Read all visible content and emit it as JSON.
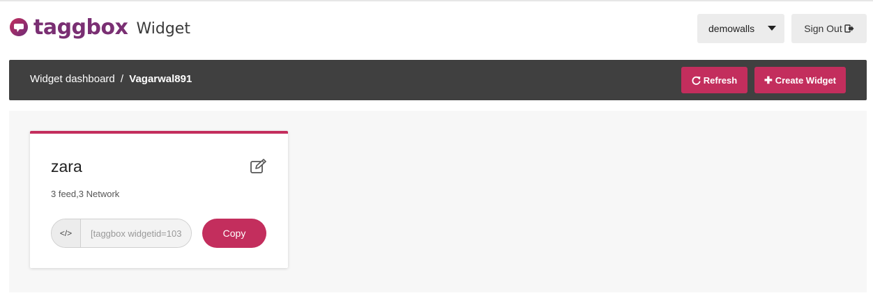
{
  "brand": {
    "name": "taggbox",
    "product": "Widget",
    "accent_color": "#c32e5d",
    "logo_color": "#7a2f73"
  },
  "header": {
    "account_label": "demowalls",
    "signout_label": "Sign Out"
  },
  "dashbar": {
    "breadcrumb_root": "Widget dashboard",
    "breadcrumb_sep": "/",
    "breadcrumb_user": "Vagarwal891",
    "refresh_label": "Refresh",
    "create_label": "Create Widget"
  },
  "widgets": [
    {
      "title": "zara",
      "meta": "3 feed,3 Network",
      "embed_code_value": "[taggbox widgetid=103",
      "code_icon_label": "</>",
      "copy_label": "Copy"
    }
  ],
  "icons": {
    "logo": "speech-bubble-icon",
    "caret": "caret-down-icon",
    "signout": "sign-out-icon",
    "refresh": "refresh-icon",
    "create": "plus-icon",
    "edit": "edit-icon",
    "code": "code-icon"
  }
}
